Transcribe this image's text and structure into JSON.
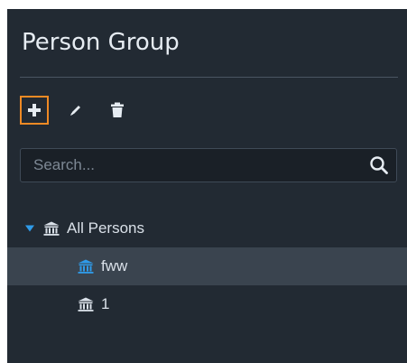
{
  "panel": {
    "title": "Person Group"
  },
  "toolbar": {
    "buttons": [
      {
        "name": "add",
        "icon": "plus-icon",
        "active": true
      },
      {
        "name": "edit",
        "icon": "pencil-icon",
        "active": false
      },
      {
        "name": "delete",
        "icon": "trash-icon",
        "active": false
      }
    ],
    "highlight_color": "#f08a24"
  },
  "search": {
    "placeholder": "Search...",
    "value": "",
    "icon": "search-icon"
  },
  "tree": {
    "root": {
      "label": "All Persons",
      "expanded": true,
      "icon": "institution-icon",
      "caret_color": "#2f9be9"
    },
    "children": [
      {
        "label": "fww",
        "selected": true,
        "icon": "institution-icon",
        "icon_color": "#2f9be9"
      },
      {
        "label": "1",
        "selected": false,
        "icon": "institution-icon",
        "icon_color": "#d9e0e8"
      }
    ]
  },
  "colors": {
    "panel_bg": "#222a33",
    "selected_row_bg": "#3a444f",
    "text": "#d9e0e8"
  }
}
